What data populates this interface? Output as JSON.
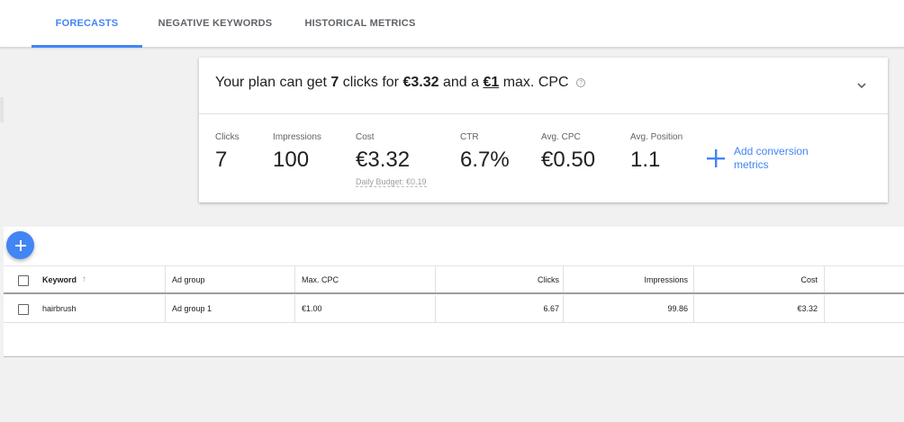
{
  "tabs": [
    {
      "label": "FORECASTS",
      "active": true
    },
    {
      "label": "NEGATIVE KEYWORDS",
      "active": false
    },
    {
      "label": "HISTORICAL METRICS",
      "active": false
    }
  ],
  "summary": {
    "prefix": "Your plan can get",
    "clicks": "7",
    "mid1": "clicks for",
    "cost": "€3.32",
    "mid2": "and a",
    "cpc": "€1",
    "suffix": "max. CPC",
    "help_icon": "help-circle-icon",
    "expand_icon": "chevron-down-icon"
  },
  "metrics": {
    "clicks": {
      "label": "Clicks",
      "value": "7"
    },
    "impressions": {
      "label": "Impressions",
      "value": "100"
    },
    "cost": {
      "label": "Cost",
      "value": "€3.32",
      "sub": "Daily Budget: €0.19"
    },
    "ctr": {
      "label": "CTR",
      "value": "6.7%"
    },
    "avg_cpc": {
      "label": "Avg. CPC",
      "value": "€0.50"
    },
    "avg_position": {
      "label": "Avg. Position",
      "value": "1.1"
    }
  },
  "add_conversion": {
    "label": "Add conversion metrics",
    "icon": "plus-icon"
  },
  "fab": {
    "icon": "plus-icon"
  },
  "table": {
    "headers": {
      "keyword": "Keyword",
      "ad_group": "Ad group",
      "max_cpc": "Max. CPC",
      "clicks": "Clicks",
      "impressions": "Impressions",
      "cost": "Cost"
    },
    "sort_icon": "arrow-up-icon",
    "rows": [
      {
        "keyword": "hairbrush",
        "ad_group": "Ad group 1",
        "max_cpc": "€1.00",
        "clicks": "6.67",
        "impressions": "99.86",
        "cost": "€3.32"
      }
    ]
  },
  "colors": {
    "accent": "#4285f4"
  }
}
